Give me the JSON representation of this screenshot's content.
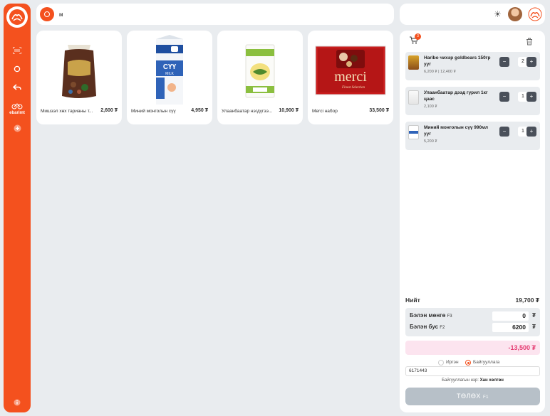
{
  "sidebar": {
    "brand": "ebarimt",
    "items": [
      "scanner-icon",
      "circle-icon",
      "undo-icon",
      "ebarimt-logo",
      "add-circle-icon",
      "info-icon"
    ]
  },
  "search": {
    "value": "м",
    "placeholder": ""
  },
  "header": {
    "theme_icon": "sun-icon",
    "avatar": "user-avatar",
    "logo": "store-logo"
  },
  "products": [
    {
      "name": "Мишээл хөх тарианы т...",
      "price": "2,600 ₮"
    },
    {
      "name": "Миний монголын сүү",
      "price": "4,950 ₮"
    },
    {
      "name": "Улаанбаатар нэгдүгээ...",
      "price": "10,900 ₮"
    },
    {
      "name": "Merci набор",
      "price": "33,500 ₮"
    }
  ],
  "product_images": {
    "milk_brand": "СҮҮ",
    "milk_sub": "MILK",
    "merci": "merci",
    "merci_sub": "Finest Selection"
  },
  "cart": {
    "count": "3",
    "items": [
      {
        "name": "Haribo чихэр goldbears 150гр ууг",
        "price": "6,200 ₮ | 12,400 ₮",
        "qty": "2"
      },
      {
        "name": "Улаанбаатар дээд гурил 1кг цаас",
        "price": "2,100 ₮",
        "qty": "1"
      },
      {
        "name": "Миний монголын сүү 990мл ууг",
        "price": "5,200 ₮",
        "qty": "1"
      }
    ],
    "minus": "−",
    "plus": "+",
    "total_label": "Нийт",
    "total": "19,700 ₮",
    "cash_label": "Бэлэн мөнгө",
    "cash_key": "F3",
    "cash_value": "0",
    "noncash_label": "Бэлэн бус",
    "noncash_key": "F2",
    "noncash_value": "6200",
    "currency": "₮",
    "difference": "-13,500 ₮",
    "radio_citizen": "Иргэн",
    "radio_org": "Байгууллага",
    "registry_no": "6171443",
    "org_name_label": "Байгууллагын нэр:",
    "org_name": "Хан хөлгөн",
    "pay_button": "ТӨЛӨХ",
    "pay_key": "F1"
  },
  "colors": {
    "accent": "#f4511e",
    "dark_btn": "#4a505a",
    "pink": "#e53970",
    "disabled": "#b7c0c8"
  }
}
